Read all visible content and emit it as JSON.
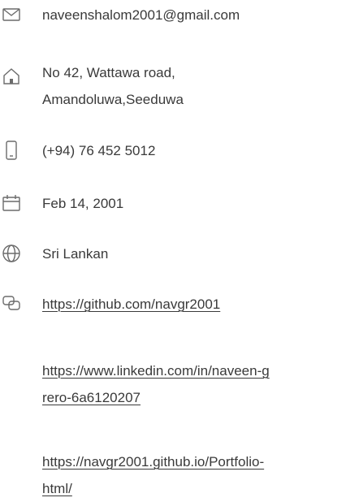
{
  "contact": {
    "email": "naveenshalom2001@gmail.com",
    "address_line1": "No 42, Wattawa road,",
    "address_line2": "Amandoluwa,Seeduwa",
    "phone": "(+94) 76 452 5012",
    "birthdate": "Feb 14, 2001",
    "nationality": "Sri Lankan",
    "links": [
      {
        "line1": "https://github.com/navgr2001",
        "line2": ""
      },
      {
        "line1": "https://www.linkedin.com/in/naveen-g",
        "line2": "rero-6a6120207"
      },
      {
        "line1": "https://navgr2001.github.io/Portfolio-",
        "line2": "html/"
      }
    ]
  },
  "icons": {
    "email": "mail-icon",
    "address": "home-icon",
    "phone": "phone-icon",
    "birthdate": "calendar-icon",
    "nationality": "globe-icon",
    "links": "link-icon"
  },
  "colors": {
    "text": "#3a3a3a",
    "icon": "#6b6b6b"
  }
}
